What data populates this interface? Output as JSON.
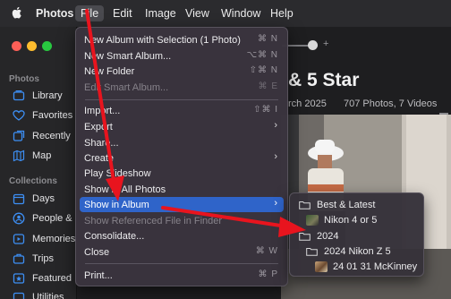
{
  "menubar": {
    "app_name": "Photos",
    "items": [
      "File",
      "Edit",
      "Image",
      "View",
      "Window",
      "Help"
    ],
    "active": "File"
  },
  "sidebar": {
    "sections": [
      {
        "heading": "Photos",
        "items": [
          {
            "label": "Library",
            "icon": "library-icon"
          },
          {
            "label": "Favorites",
            "icon": "heart-icon"
          },
          {
            "label": "Recently",
            "icon": "recently-icon"
          },
          {
            "label": "Map",
            "icon": "map-icon"
          }
        ]
      },
      {
        "heading": "Collections",
        "items": [
          {
            "label": "Days",
            "icon": "calendar-icon"
          },
          {
            "label": "People &",
            "icon": "people-icon"
          },
          {
            "label": "Memories",
            "icon": "memories-icon"
          },
          {
            "label": "Trips",
            "icon": "suitcase-icon"
          },
          {
            "label": "Featured",
            "icon": "featured-icon"
          },
          {
            "label": "Utilities",
            "icon": "utilities-icon"
          }
        ]
      }
    ]
  },
  "content": {
    "title": "& 5 Star",
    "subtitle": "rch 2025",
    "count": "707 Photos, 7 Videos"
  },
  "file_menu": {
    "items": [
      {
        "label": "New Album with Selection (1 Photo)",
        "shortcut": "⌘ N",
        "disabled": false
      },
      {
        "label": "New Smart Album...",
        "shortcut": "⌥⌘ N",
        "disabled": false
      },
      {
        "label": "New Folder",
        "shortcut": "⇧⌘ N",
        "disabled": false
      },
      {
        "label": "Edit Smart Album...",
        "shortcut": "⌘ E",
        "disabled": true
      },
      {
        "label": "Import...",
        "shortcut": "⇧⌘ I",
        "disabled": false
      },
      {
        "label": "Export",
        "shortcut": "",
        "disabled": false,
        "submenu": true
      },
      {
        "label": "Share...",
        "shortcut": "",
        "disabled": false
      },
      {
        "label": "Create",
        "shortcut": "",
        "disabled": false,
        "submenu": true
      },
      {
        "label": "Play Slideshow",
        "shortcut": "",
        "disabled": false
      },
      {
        "label": "Show in All Photos",
        "shortcut": "",
        "disabled": false
      },
      {
        "label": "Show in Album",
        "shortcut": "",
        "disabled": false,
        "submenu": true,
        "highlighted": true
      },
      {
        "label": "Show Referenced File in Finder",
        "shortcut": "",
        "disabled": true
      },
      {
        "label": "Consolidate...",
        "shortcut": "",
        "disabled": false
      },
      {
        "label": "Close",
        "shortcut": "⌘ W",
        "disabled": false
      },
      {
        "label": "Print...",
        "shortcut": "⌘ P",
        "disabled": false
      }
    ]
  },
  "album_submenu": {
    "items": [
      {
        "label": "Best & Latest",
        "kind": "folder"
      },
      {
        "label": "Nikon 4 or 5",
        "kind": "album"
      },
      {
        "label": "2024",
        "kind": "folder"
      },
      {
        "label": "2024 Nikon Z 5",
        "kind": "folder"
      },
      {
        "label": "24 01 31 McKinney",
        "kind": "album"
      }
    ]
  },
  "colors": {
    "highlight": "#2f64c9",
    "annotation_arrow": "#e8141e",
    "menu_bg": "#3a343e"
  }
}
